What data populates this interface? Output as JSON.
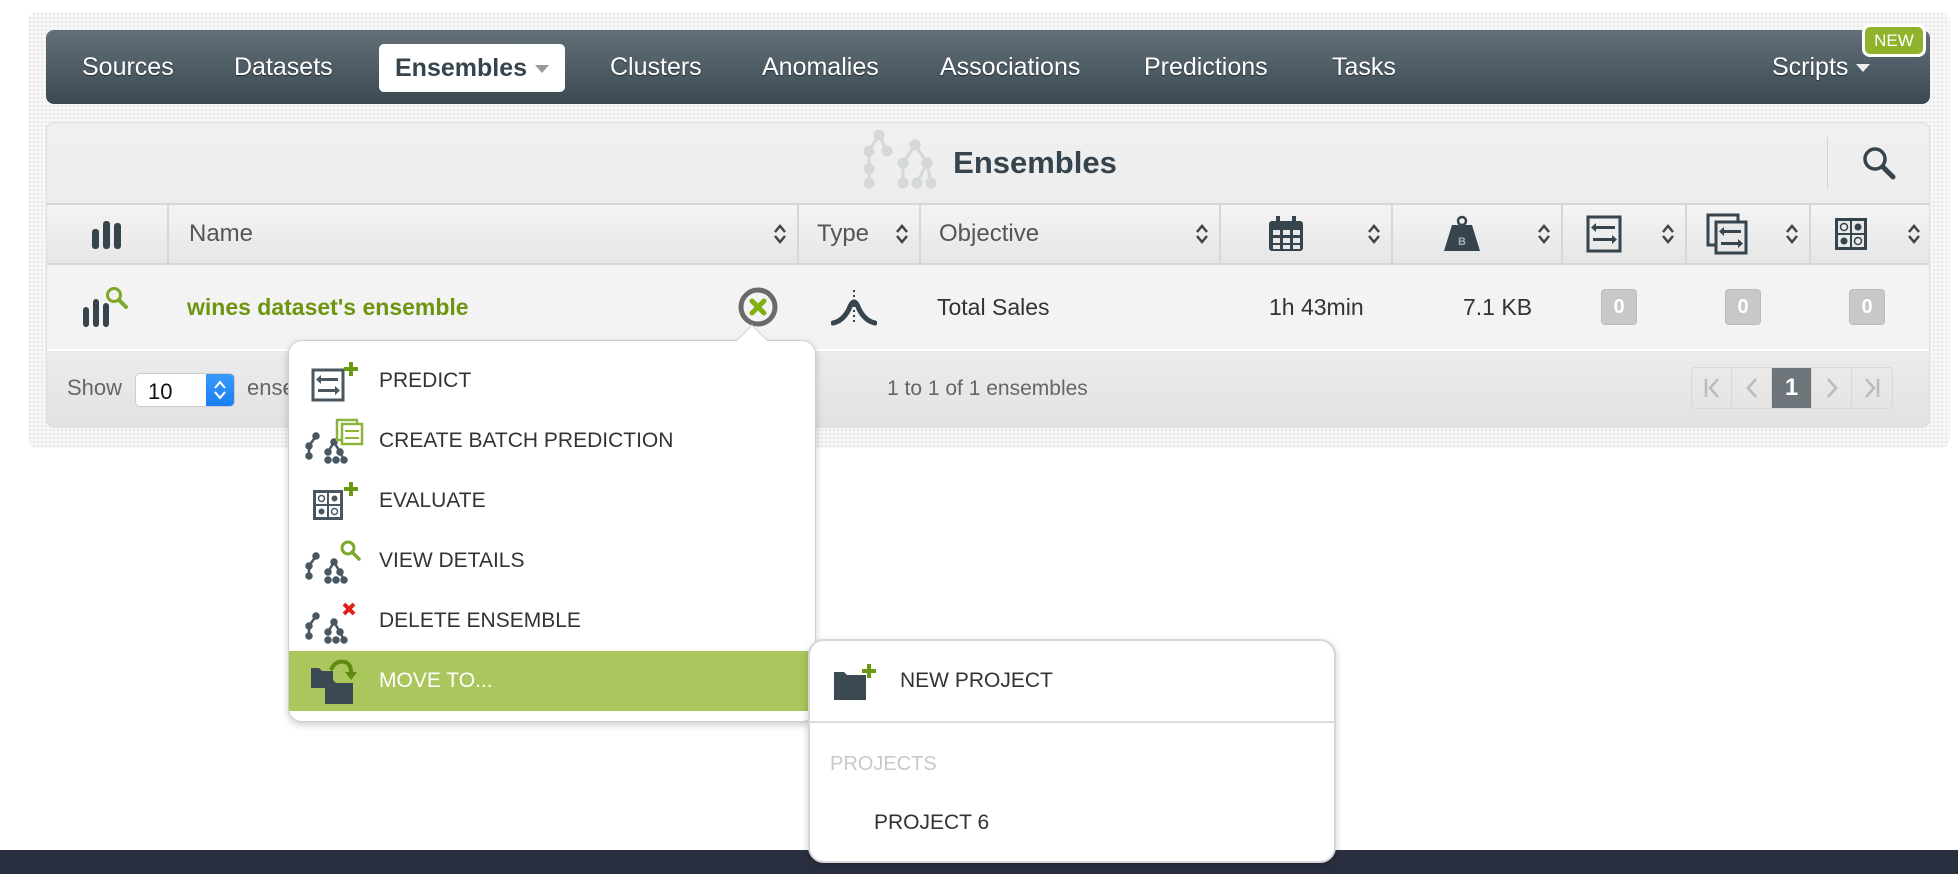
{
  "nav": {
    "items": [
      {
        "label": "Sources"
      },
      {
        "label": "Datasets"
      },
      {
        "label": "Ensembles",
        "active": true
      },
      {
        "label": "Clusters"
      },
      {
        "label": "Anomalies"
      },
      {
        "label": "Associations"
      },
      {
        "label": "Predictions"
      },
      {
        "label": "Tasks"
      }
    ],
    "scripts_label": "Scripts",
    "new_badge": "NEW"
  },
  "panel": {
    "title": "Ensembles",
    "columns": {
      "name": "Name",
      "type": "Type",
      "objective": "Objective",
      "created": "calendar-icon",
      "size": "weight-icon",
      "predictions": "prediction-icon",
      "batch_predictions": "batch-prediction-icon",
      "evaluations": "evaluation-icon"
    },
    "rows": [
      {
        "name": "wines dataset's ensemble",
        "type_icon": "regression-icon",
        "objective": "Total Sales",
        "age": "1h 43min",
        "size": "7.1 KB",
        "predictions": "0",
        "batch_predictions": "0",
        "evaluations": "0"
      }
    ],
    "footer": {
      "show_label": "Show",
      "page_size": "10",
      "show_suffix": "ense",
      "count_text": "1 to 1 of 1 ensembles",
      "current_page": "1"
    }
  },
  "context_menu": {
    "items": [
      {
        "label": "PREDICT",
        "icon": "predict-icon"
      },
      {
        "label": "CREATE BATCH PREDICTION",
        "icon": "batch-prediction-icon"
      },
      {
        "label": "EVALUATE",
        "icon": "evaluate-icon"
      },
      {
        "label": "VIEW DETAILS",
        "icon": "view-details-icon"
      },
      {
        "label": "DELETE ENSEMBLE",
        "icon": "delete-icon"
      },
      {
        "label": "MOVE TO...",
        "icon": "move-icon",
        "active": true
      }
    ]
  },
  "submenu": {
    "new_project": "NEW PROJECT",
    "projects_label": "PROJECTS",
    "projects": [
      "PROJECT 6"
    ]
  },
  "colors": {
    "accent_green": "#aac65c",
    "link_green": "#6f9410",
    "nav_dark": "#3b4953"
  }
}
